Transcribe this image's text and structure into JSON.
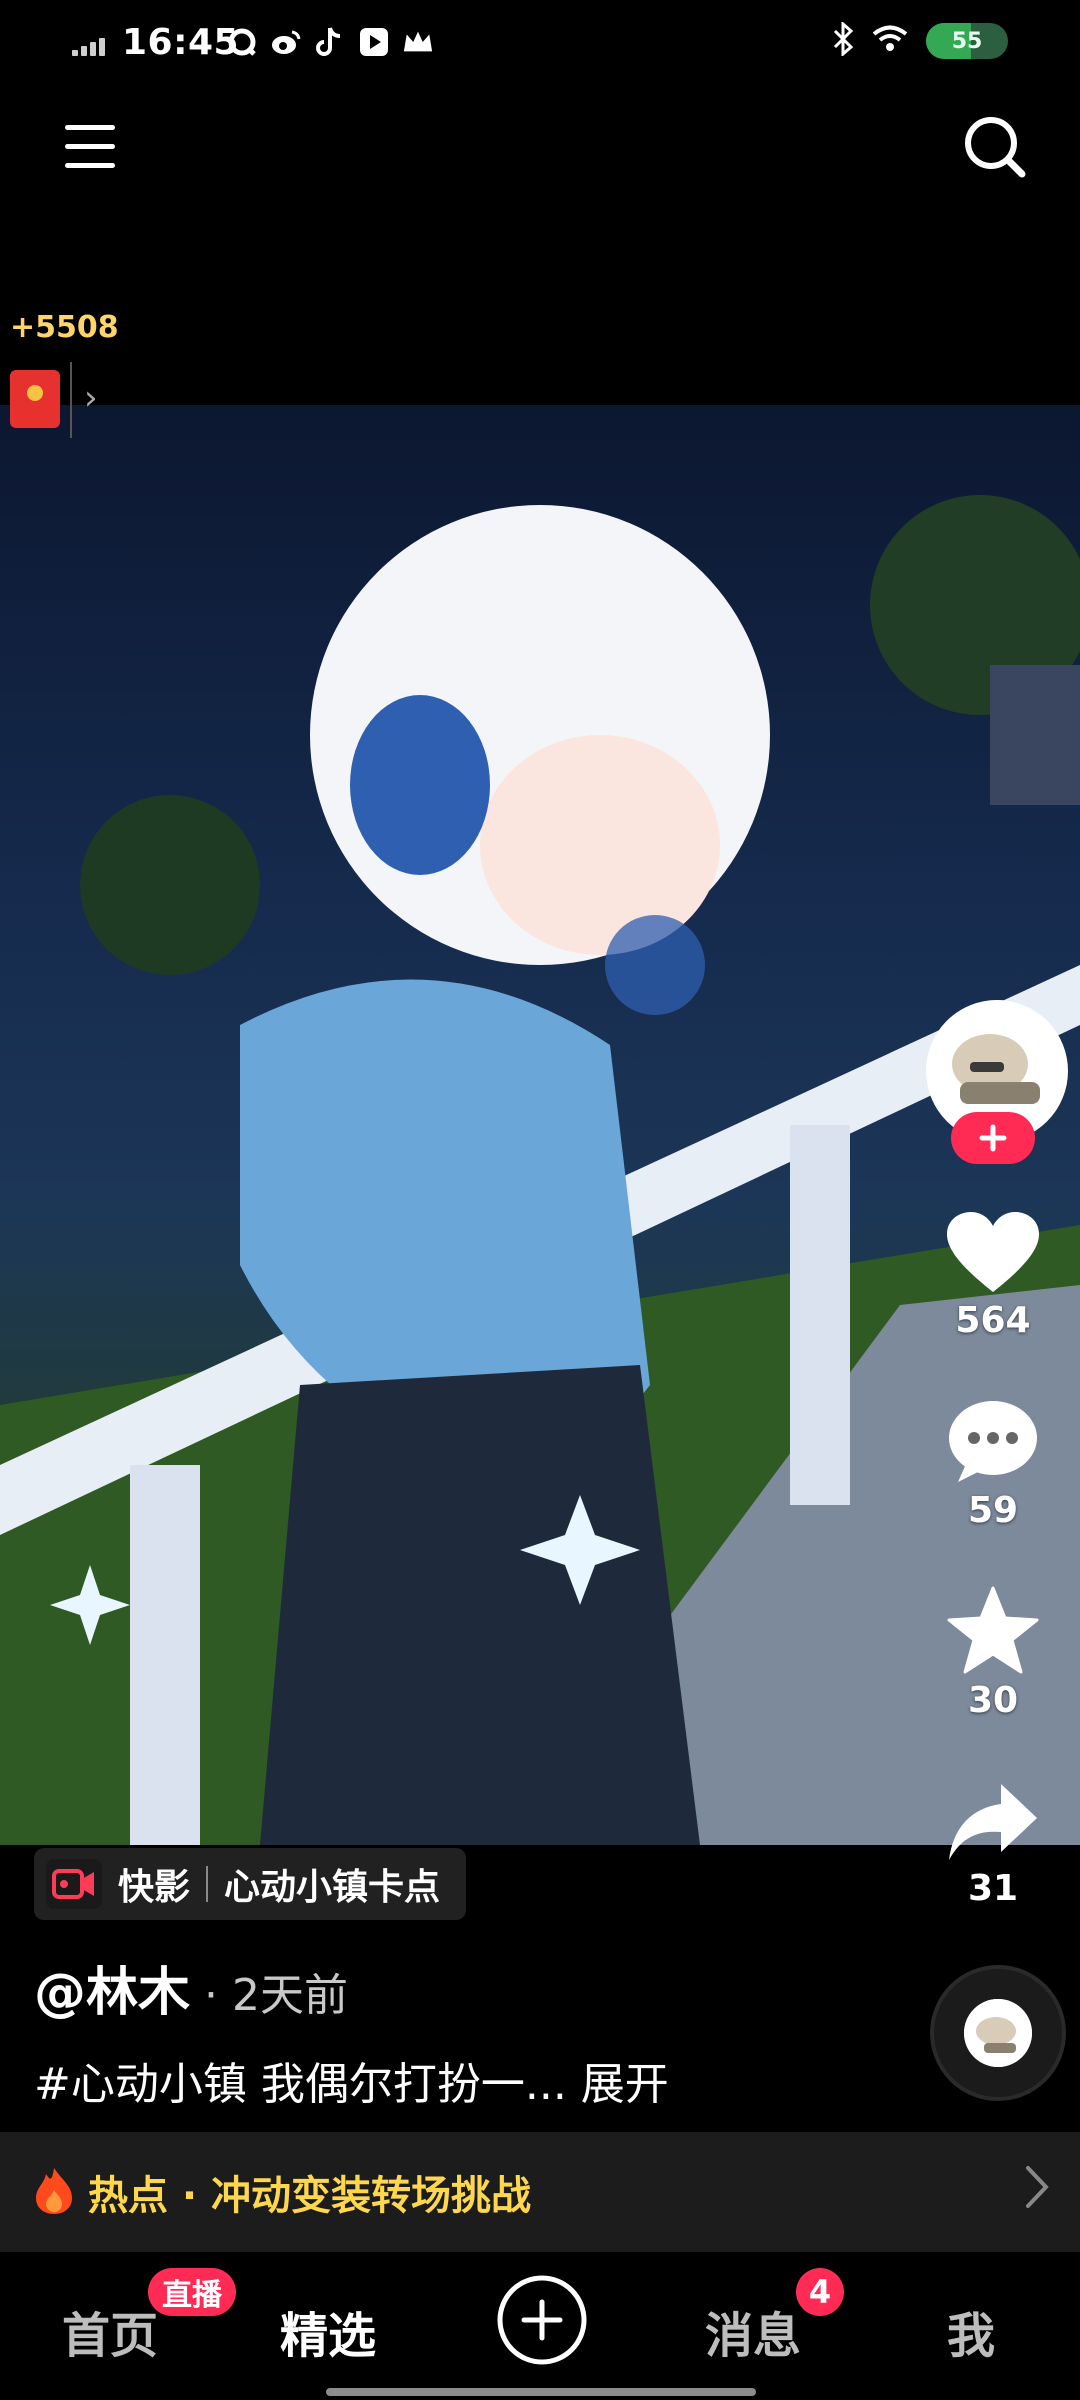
{
  "status_bar": {
    "time": "16:45",
    "battery": "55",
    "battery_level": 0.55,
    "app_icons": [
      "qq-browser-icon",
      "weibo-icon",
      "douyin-icon",
      "video-icon",
      "crown-icon"
    ]
  },
  "reward": {
    "coins": "+5508"
  },
  "video": {
    "tool": {
      "app": "快影",
      "template": "心动小镇卡点"
    },
    "author": "@林木",
    "posted": "· 2天前",
    "description": "#心动小镇 我偶尔打扮一... 展开"
  },
  "actions": {
    "likes": "564",
    "comments": "59",
    "favorites": "30",
    "shares": "31"
  },
  "hot_topic": {
    "label": "热点 · 冲动变装转场挑战"
  },
  "nav": {
    "items": [
      "首页",
      "精选",
      "消息",
      "我"
    ],
    "live_badge": "直播",
    "message_badge": "4"
  },
  "colors": {
    "accent": "#ff2b55",
    "hot_text": "#ffd74d",
    "coin_text": "#ffd46a"
  }
}
